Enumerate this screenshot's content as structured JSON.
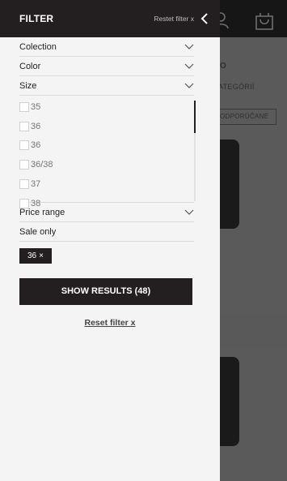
{
  "panel": {
    "title": "FILTER",
    "header_reset": "Restet filter x"
  },
  "filters": {
    "collection": "Colection",
    "color": "Color",
    "size": "Size",
    "price_range": "Price range",
    "sale_only": "Sale only"
  },
  "sizes": [
    "35",
    "36",
    "36",
    "36/38",
    "37",
    "38"
  ],
  "active_chip": {
    "label": "36",
    "remove": "×"
  },
  "actions": {
    "show_results": "SHOW RESULTS (48)",
    "reset_filter": "Reset filter x"
  },
  "background": {
    "text_o": "O",
    "text_categories": "ATEGÓRIÍ",
    "sort_label": "ODPORÚČANÉ"
  },
  "colors": {
    "panel_bg": "#f4f4f4",
    "dark": "#231f20"
  },
  "icons": {
    "back": "chevron-left-icon",
    "expand": "chevron-down-icon",
    "user": "user-icon",
    "cart": "shopping-bag-icon"
  }
}
